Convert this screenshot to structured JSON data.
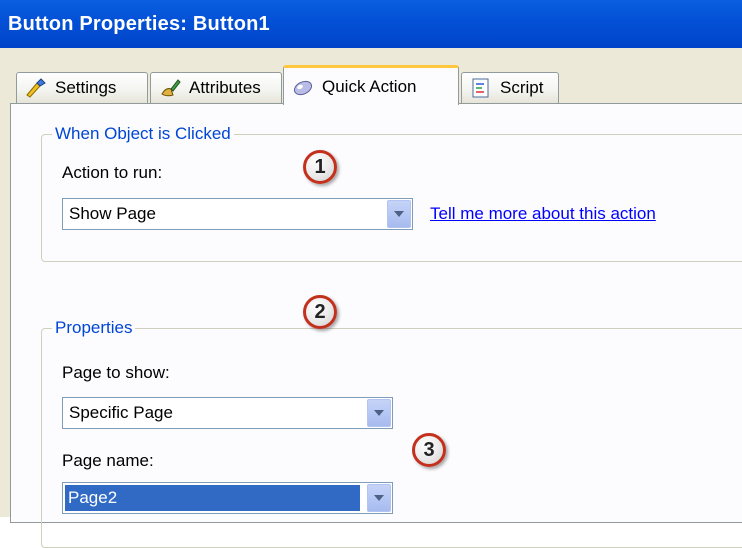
{
  "window": {
    "title": "Button Properties: Button1"
  },
  "tabs": [
    {
      "label": "Settings",
      "icon": "settings-icon"
    },
    {
      "label": "Attributes",
      "icon": "attributes-icon"
    },
    {
      "label": "Quick Action",
      "icon": "quick-action-icon",
      "active": true
    },
    {
      "label": "Script",
      "icon": "script-icon"
    }
  ],
  "when_clicked": {
    "legend": "When Object is Clicked",
    "action_label": "Action to run:",
    "action_value": "Show Page",
    "help_link": "Tell me more about this action"
  },
  "properties": {
    "legend": "Properties",
    "page_to_show_label": "Page to show:",
    "page_to_show_value": "Specific Page",
    "page_name_label": "Page name:",
    "page_name_value": "Page2"
  },
  "callouts": [
    "1",
    "2",
    "3"
  ],
  "colors": {
    "titlebar": "#0350d6",
    "legend": "#0046d5",
    "link": "#0000ff",
    "selection": "#316ac5",
    "callout_border": "#c3311d",
    "active_tab_accent": "#ffc83c"
  }
}
